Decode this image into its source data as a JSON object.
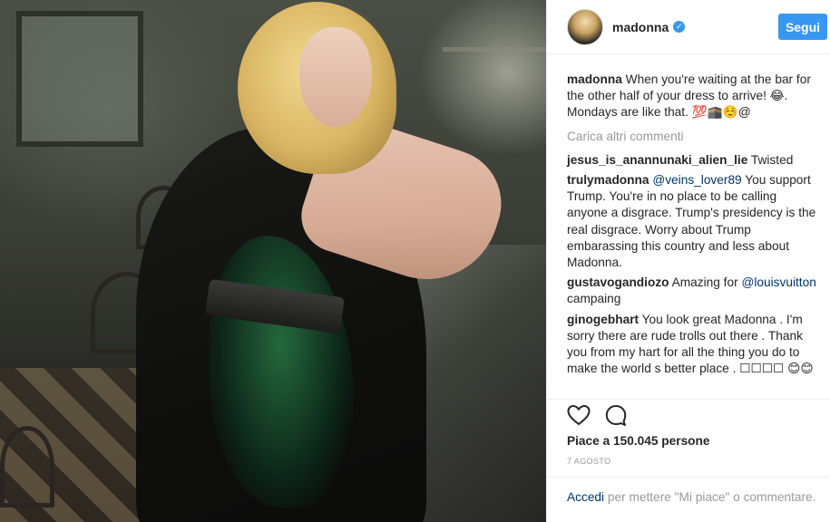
{
  "post": {
    "username": "madonna",
    "follow_label": "Segui",
    "caption": {
      "user": "madonna",
      "text": "When you're waiting at the bar for the other half of your dress to arrive! 😂. Mondays are like that. 💯🕋☺️@"
    },
    "load_more": "Carica altri commenti",
    "comments": [
      {
        "user": "jesus_is_anannunaki_alien_lie",
        "pre": "Twisted",
        "mention": "",
        "post": ""
      },
      {
        "user": "trulymadonna",
        "pre": "",
        "mention": "@veins_lover89",
        "post": " You support Trump. You're in no place to be calling anyone a disgrace. Trump's presidency is the real disgrace. Worry about Trump embarassing this country and less about Madonna."
      },
      {
        "user": "gustavogandiozo",
        "pre": "Amazing for ",
        "mention": "@louisvuitton",
        "post": " campaing"
      },
      {
        "user": "ginogebhart",
        "pre": "You look great Madonna . I'm sorry there are rude trolls out there . Thank you from my hart for all the thing you do to make the world s better place . ☐☐☐☐ 😊😊",
        "mention": "",
        "post": ""
      }
    ],
    "likes": "Piace a 150.045 persone",
    "date": "7 AGOSTO",
    "footer": {
      "login_link": "Accedi",
      "rest": " per mettere \"Mi piace\" o commentare."
    }
  },
  "colors": {
    "accent": "#3897f0",
    "link": "#003569",
    "muted": "#999999"
  },
  "icons": [
    "verified-badge-icon",
    "heart-icon",
    "comment-icon"
  ]
}
